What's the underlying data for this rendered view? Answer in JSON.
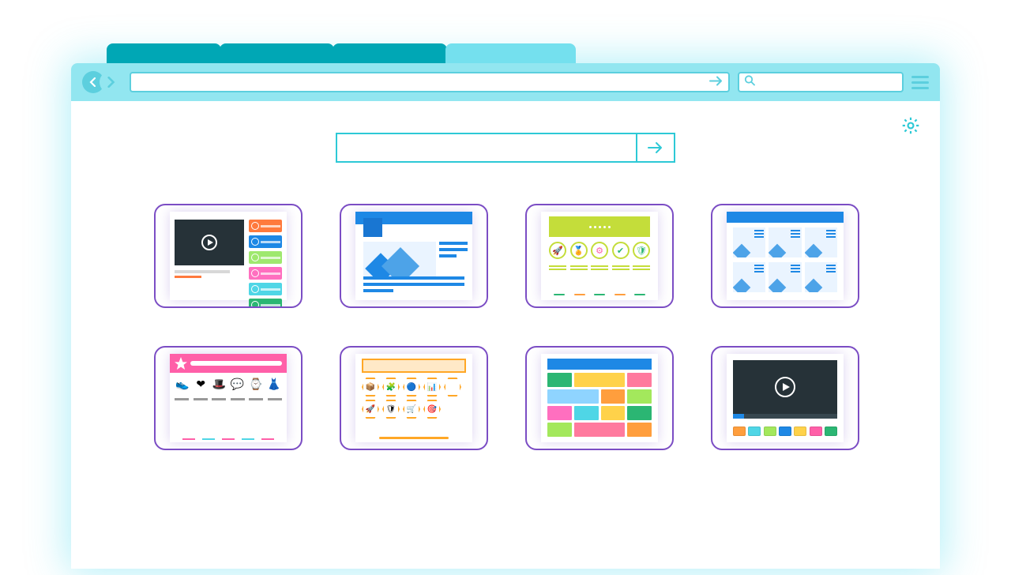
{
  "browser": {
    "tabs": [
      {
        "active": false
      },
      {
        "active": false
      },
      {
        "active": false
      },
      {
        "active": true
      }
    ],
    "address_bar": {
      "value": "",
      "placeholder": ""
    },
    "search_bar": {
      "value": "",
      "placeholder": ""
    }
  },
  "page": {
    "search_box": {
      "value": "",
      "placeholder": ""
    },
    "thumbnails": [
      {
        "kind": "video-site"
      },
      {
        "kind": "blog"
      },
      {
        "kind": "features"
      },
      {
        "kind": "dashboard"
      },
      {
        "kind": "ecommerce"
      },
      {
        "kind": "hex-icons"
      },
      {
        "kind": "color-tiles"
      },
      {
        "kind": "video-player"
      }
    ]
  },
  "colors": {
    "chrome": "#92e6f0",
    "chrome_accent": "#5ccfde",
    "tab_inactive": "#00a7b5",
    "tab_active": "#74e0ee",
    "thumb_border": "#7b4dc4"
  }
}
